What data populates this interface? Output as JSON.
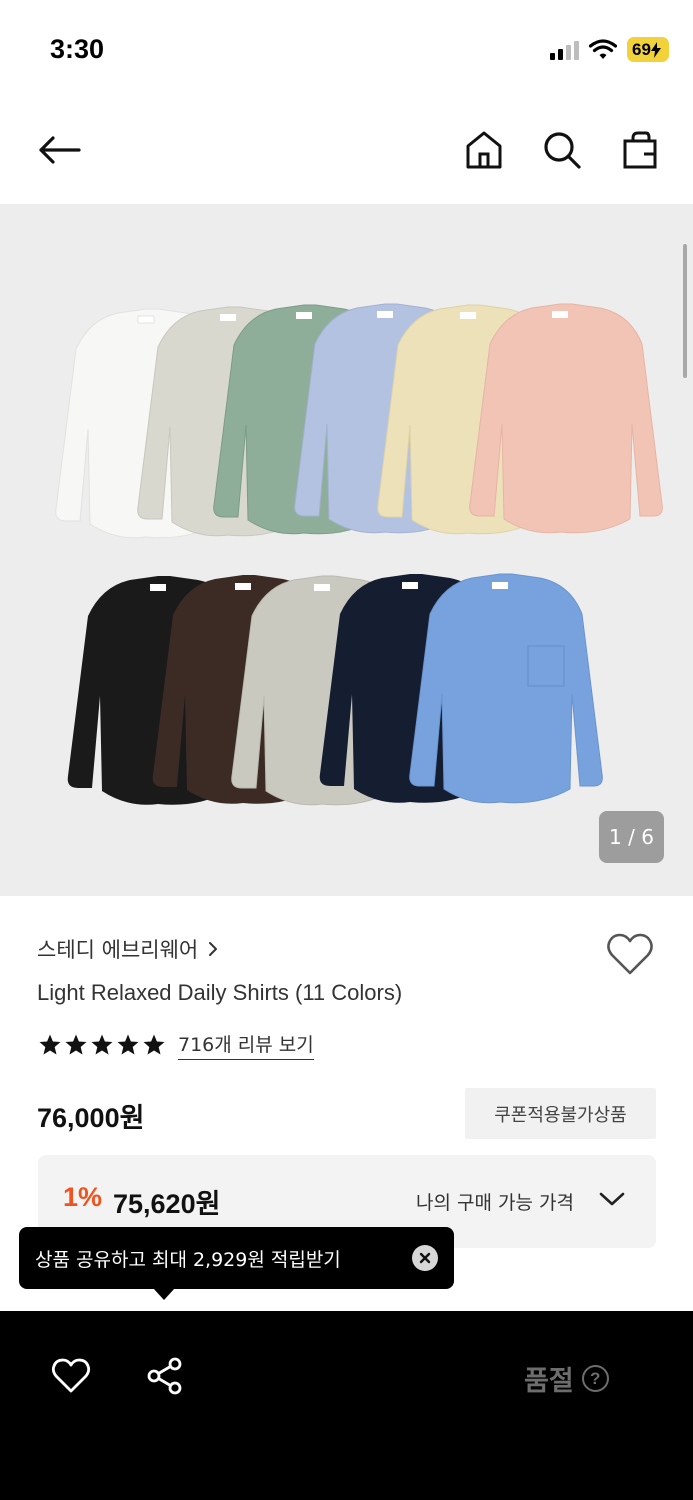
{
  "status_bar": {
    "time": "3:30",
    "battery": "69"
  },
  "gallery": {
    "page_indicator": "1 / 6"
  },
  "product": {
    "brand": "스테디 에브리웨어",
    "name": "Light Relaxed Daily Shirts (11 Colors)",
    "rating_stars": 5,
    "review_link": "716개 리뷰 보기",
    "price": "76,000원",
    "coupon_badge": "쿠폰적용불가상품"
  },
  "my_price": {
    "discount": "1%",
    "price": "75,620원",
    "label": "나의 구매 가능 가격"
  },
  "tooltip": {
    "text": "상품 공유하고 최대 2,929원 적립받기"
  },
  "bottom_bar": {
    "soldout_label": "품절",
    "help_glyph": "?"
  },
  "colors": {
    "accent_discount": "#f2521d",
    "battery": "#f2d23a",
    "shirts_top_row": [
      "#f7f7f5",
      "#d9d8cf",
      "#8fae9a",
      "#b4c2e2",
      "#ece1b8",
      "#f2c4b5"
    ],
    "shirts_bottom_row": [
      "#1a1a1a",
      "#3b2b24",
      "#c9c9bf",
      "#151d31",
      "#78a2dd"
    ]
  }
}
